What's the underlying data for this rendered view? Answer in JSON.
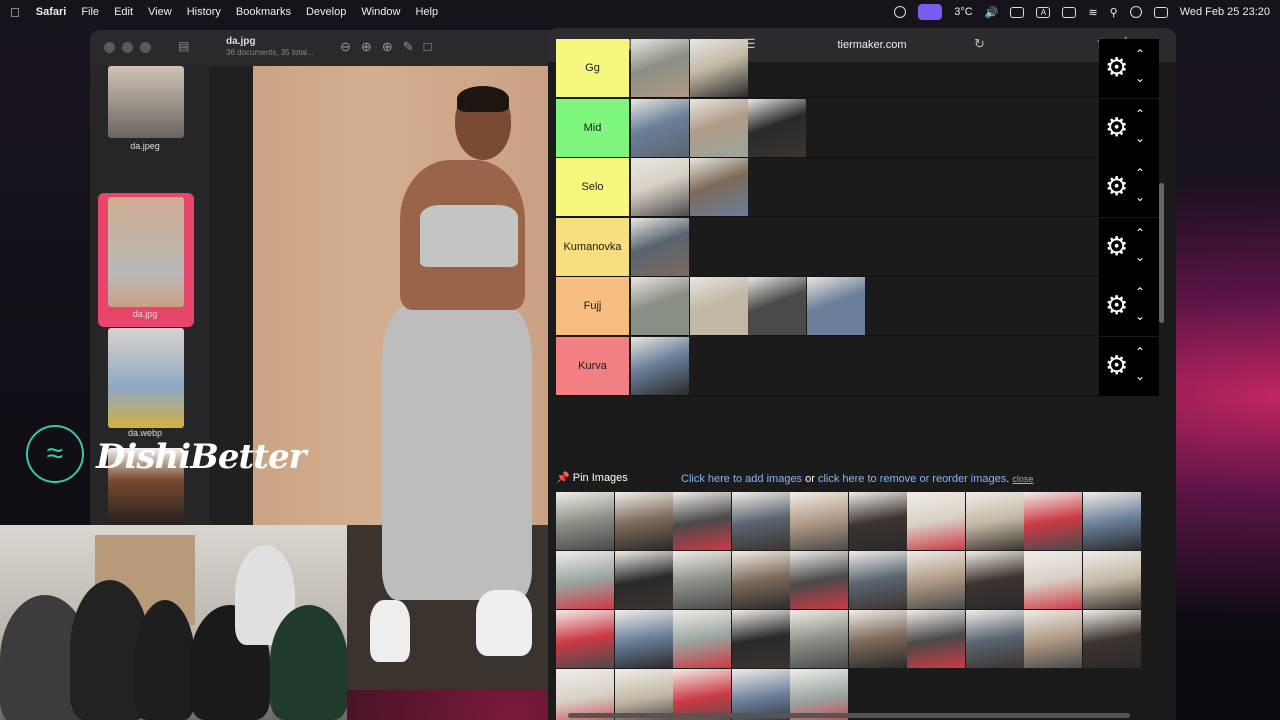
{
  "menubar": {
    "app": "Safari",
    "items": [
      "File",
      "Edit",
      "View",
      "History",
      "Bookmarks",
      "Develop",
      "Window",
      "Help"
    ],
    "temp": "3°C",
    "input_indicator": "A",
    "datetime": "Wed Feb 25  23:20"
  },
  "preview": {
    "title": "da.jpg",
    "subtitle": "36 documents, 35 total...",
    "thumbs": [
      {
        "label": "da.jpeg"
      },
      {
        "label": "da.jpg"
      },
      {
        "label": "da.webp"
      }
    ]
  },
  "watermark": {
    "text": "DishiBetter"
  },
  "safari": {
    "url": "tiermaker.com",
    "tiers": [
      {
        "label": "Gg",
        "color": "#f5f77f",
        "count": 2
      },
      {
        "label": "Mid",
        "color": "#7ff77f",
        "count": 3
      },
      {
        "label": "Selo",
        "color": "#f5f77f",
        "count": 2
      },
      {
        "label": "Kumanovka",
        "color": "#f7df7f",
        "count": 1
      },
      {
        "label": "Fujj",
        "color": "#f7bf7f",
        "count": 4
      },
      {
        "label": "Kurva",
        "color": "#f27f82",
        "count": 1
      }
    ],
    "pin_label": "Pin Images",
    "add_link": "Click here to add images",
    "or_text": " or ",
    "remove_link": "click here to remove or reorder images",
    "period": ".",
    "close_link": "close"
  }
}
